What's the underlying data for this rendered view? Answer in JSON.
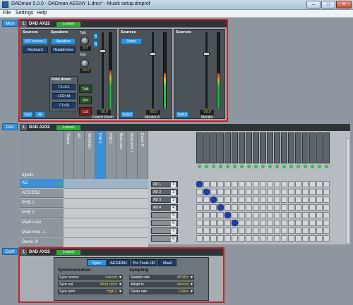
{
  "window": {
    "title": "DADman 5.0.0 - DADman AESNY 1.dms* - Musik setup.dmprof"
  },
  "menu": [
    "File",
    "Settings",
    "Help"
  ],
  "side_tabs": {
    "mon": "Mon",
    "con": "Con",
    "conf": "Conf"
  },
  "device": {
    "num": "1",
    "name": "DAD AX32",
    "status": "Locked"
  },
  "monitor": {
    "control_room": {
      "sources_title": "Sources",
      "sources_buttons": [
        "VST source 1",
        "Keyboard"
      ],
      "speakers_title": "Speakers",
      "speakers_buttons": [
        "Speakers",
        "Headphones"
      ],
      "fold_down_title": "Fold down",
      "fold_down_buttons": [
        "7.1>5.1",
        "LCR>St",
        "7.1>St"
      ],
      "talk_label": "Talk",
      "talk_value": "0.0",
      "dim_label": "Dim",
      "dim_value": "-20.0",
      "talk_button": "Talk",
      "dim_button": "Dim",
      "cut_button": "Cut",
      "sum_button": "Sum",
      "all_button": "All",
      "side_buttons": [
        "S",
        "R"
      ],
      "fader_value": "-20.0",
      "name": "Control Room"
    },
    "monitor_a": {
      "sources_title": "Sources",
      "source_button": "Dante",
      "switch_label": "Switch",
      "fader_value": "-20.0",
      "name": "Monitor A"
    },
    "monitor": {
      "sources_title": "Sources",
      "switch_label": "Switch",
      "fader_value": "-20.0",
      "name": "Monitor"
    }
  },
  "routing": {
    "inputs_label": "Inputs",
    "inputs": [
      "AD",
      "AES/EBU",
      "PHD 1",
      "PHD 2",
      "Madi coax",
      "Madi mod. 1",
      "Dante IP"
    ],
    "input_columns": [
      "Output",
      "AD",
      "AES/EBU",
      "PHD 1",
      "PHD 2",
      "Madi coax",
      "Madi mod. 1",
      "Dante IP"
    ],
    "outputs": [
      "AD 1",
      "AD 2",
      "AD 3",
      "AD 4",
      "",
      "",
      "",
      ""
    ],
    "output_numbers": [
      "1",
      "2",
      "3",
      "4",
      "5",
      "6",
      "7",
      "8"
    ]
  },
  "config": {
    "tabs": [
      "Sync",
      "AES/EBU",
      "Pro Tools HD",
      "Madi"
    ],
    "sync_title": "Synchronization",
    "sync_rows": [
      {
        "label": "Sync source",
        "value": "Internal"
      },
      {
        "label": "Sync out",
        "value": "Word clock"
      },
      {
        "label": "Sync term",
        "value": "High Z"
      }
    ],
    "sampling_title": "Sampling",
    "sampling_rows": [
      {
        "label": "Sample rate",
        "value": "48 KHz"
      },
      {
        "label": "Adapt to",
        "value": "Internal"
      },
      {
        "label": "Dante rate",
        "value": "Follow"
      }
    ]
  },
  "colors": {
    "accent": "#2f95df",
    "section_border": "#c7202a",
    "locked": "#2fa83c",
    "route_dot": "#1b3fc4"
  }
}
